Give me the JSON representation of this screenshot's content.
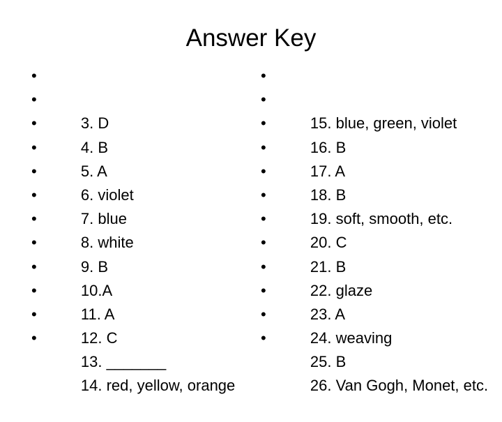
{
  "slide": {
    "title": "Answer Key",
    "background_color": "#FFFFFF",
    "text_color": "#000000",
    "bullet_glyph": "•"
  },
  "columns": {
    "left": {
      "items": [
        {
          "text": "3. D"
        },
        {
          "text": "4. B"
        },
        {
          "text": "5. A"
        },
        {
          "text": "6. violet"
        },
        {
          "text": "7. blue"
        },
        {
          "text": "8. white"
        },
        {
          "text": "9. B"
        },
        {
          "text": "10.A"
        },
        {
          "text": "11. A"
        },
        {
          "text": "12. C"
        },
        {
          "text": "13. _______"
        },
        {
          "text": "14. red, yellow, orange"
        }
      ]
    },
    "right": {
      "items": [
        {
          "text": "15. blue, green, violet"
        },
        {
          "text": "16. B"
        },
        {
          "text": "17. A"
        },
        {
          "text": "18. B"
        },
        {
          "text": "19. soft, smooth, etc."
        },
        {
          "text": "20. C"
        },
        {
          "text": "21. B"
        },
        {
          "text": "22. glaze"
        },
        {
          "text": "23. A"
        },
        {
          "text": "24. weaving"
        },
        {
          "text": "25. B"
        },
        {
          "text": "26. Van Gogh, Monet, etc."
        }
      ]
    }
  }
}
